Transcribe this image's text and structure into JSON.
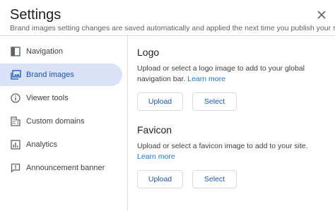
{
  "dialog": {
    "title": "Settings",
    "subtitle": "Brand images setting changes are saved automatically and applied the next time you publish your site"
  },
  "sidebar": {
    "items": [
      {
        "label": "Navigation",
        "icon": "navigation-icon",
        "active": false
      },
      {
        "label": "Brand images",
        "icon": "image-icon",
        "active": true
      },
      {
        "label": "Viewer tools",
        "icon": "info-icon",
        "active": false
      },
      {
        "label": "Custom domains",
        "icon": "building-icon",
        "active": false
      },
      {
        "label": "Analytics",
        "icon": "analytics-icon",
        "active": false
      },
      {
        "label": "Announcement banner",
        "icon": "announcement-icon",
        "active": false
      }
    ]
  },
  "logo": {
    "title": "Logo",
    "description": "Upload or select a logo image to add to your global navigation bar.",
    "link": "Learn more",
    "upload_label": "Upload",
    "select_label": "Select"
  },
  "favicon": {
    "title": "Favicon",
    "description": "Upload or select a favicon image to add to your site.",
    "link": "Learn more",
    "upload_label": "Upload",
    "select_label": "Select"
  },
  "colors": {
    "accent": "#1a73e8",
    "active_bg": "#d9e2f7",
    "active_text": "#1a56b4"
  }
}
